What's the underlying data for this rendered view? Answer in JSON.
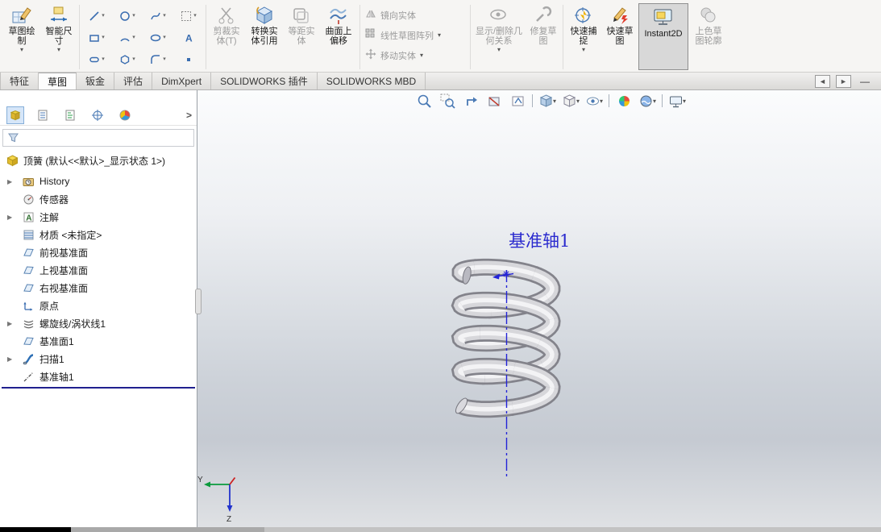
{
  "ribbon": {
    "sketch": "草图绘制",
    "smart_dimension": "智能尺寸",
    "trim_entities": "剪裁实体(T)",
    "convert_entities": "转换实体引用",
    "offset_entities": "等距实体",
    "surface_offset": "曲面上偏移",
    "mirror_entities": "镜向实体",
    "linear_sketch_pattern": "线性草图阵列",
    "move_entities": "移动实体",
    "display_delete_relations": "显示/删除几何关系",
    "repair_sketch": "修复草图",
    "quick_snaps": "快速捕捉",
    "rapid_sketch": "快速草图",
    "instant2d": "Instant2D",
    "shaded_sketch_contours": "上色草图轮廓"
  },
  "tabs": [
    {
      "label": "特征",
      "active": false
    },
    {
      "label": "草图",
      "active": true
    },
    {
      "label": "钣金",
      "active": false
    },
    {
      "label": "评估",
      "active": false
    },
    {
      "label": "DimXpert",
      "active": false
    },
    {
      "label": "SOLIDWORKS 插件",
      "active": false
    },
    {
      "label": "SOLIDWORKS MBD",
      "active": false
    }
  ],
  "feature_tree": {
    "root": "顶簧 (默认<<默认>_显示状态 1>)",
    "items": [
      {
        "label": "History",
        "icon": "history-folder-icon",
        "expandable": true
      },
      {
        "label": "传感器",
        "icon": "sensors-icon",
        "expandable": false
      },
      {
        "label": "注解",
        "icon": "annotations-folder-icon",
        "expandable": true
      },
      {
        "label": "材质 <未指定>",
        "icon": "material-icon",
        "expandable": false
      },
      {
        "label": "前视基准面",
        "icon": "plane-icon",
        "expandable": false
      },
      {
        "label": "上视基准面",
        "icon": "plane-icon",
        "expandable": false
      },
      {
        "label": "右视基准面",
        "icon": "plane-icon",
        "expandable": false
      },
      {
        "label": "原点",
        "icon": "origin-icon",
        "expandable": false
      },
      {
        "label": "螺旋线/涡状线1",
        "icon": "helix-icon",
        "expandable": true
      },
      {
        "label": "基准面1",
        "icon": "plane-icon",
        "expandable": false
      },
      {
        "label": "扫描1",
        "icon": "sweep-icon",
        "expandable": true
      },
      {
        "label": "基准轴1",
        "icon": "axis-icon",
        "expandable": false,
        "selected": true
      }
    ]
  },
  "viewport": {
    "axis_label": "基准轴1",
    "triad": {
      "y_label": "Y",
      "z_label": "Z"
    }
  },
  "headsup_icons": [
    "zoom-to-fit",
    "zoom-to-area",
    "previous-view",
    "section-view",
    "3d-drawing-view",
    "view-orientation",
    "display-style",
    "hide-show-items",
    "edit-appearance",
    "apply-scene",
    "view-settings"
  ],
  "colors": {
    "axis_blue": "#2323d8",
    "rollback_bar_blue": "#20208f",
    "viewport_gradient_top": "#fbfcfd",
    "viewport_gradient_bottom": "#c5cad2",
    "instant2d_active_bg": "#d8d8d8"
  }
}
